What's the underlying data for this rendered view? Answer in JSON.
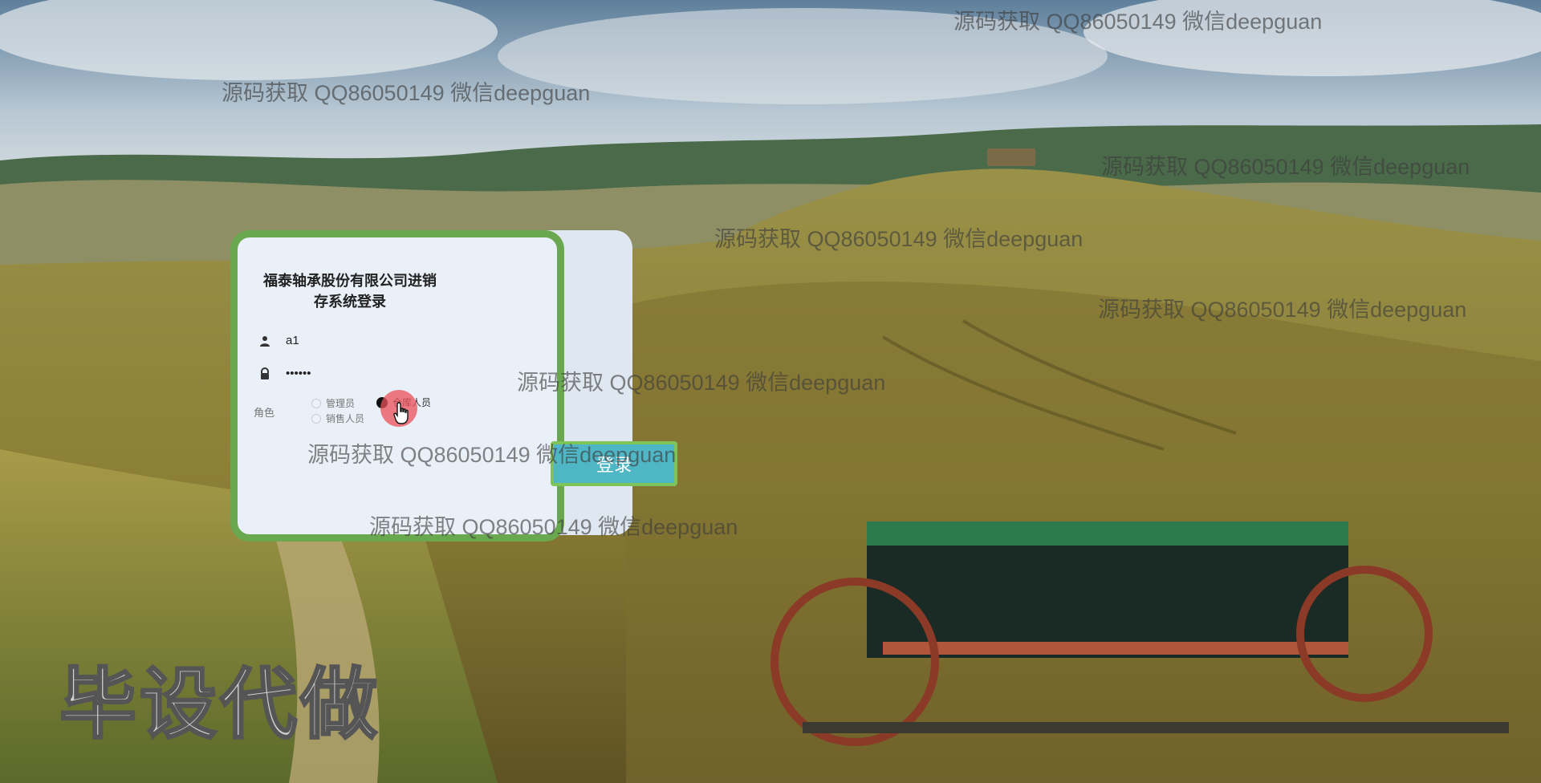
{
  "login": {
    "title_line1": "福泰轴承股份有限公司进销",
    "title_line2": "存系统登录",
    "username_value": "a1",
    "password_value": "••••••",
    "role_label": "角色",
    "roles": [
      {
        "label": "管理员",
        "checked": false
      },
      {
        "label": "仓库人员",
        "checked": true
      },
      {
        "label": "销售人员",
        "checked": false
      }
    ],
    "submit_label": "登录"
  },
  "icons": {
    "username": "user-icon",
    "password": "lock-icon",
    "cursor": "hand-pointer-icon"
  },
  "colors": {
    "panel_border": "#6aa84f",
    "button_bg": "#4fb6c6",
    "cursor_highlight": "#eb505a"
  },
  "watermark": "源码获取 QQ86050149 微信deepguan",
  "overlay_text": "毕设代做"
}
